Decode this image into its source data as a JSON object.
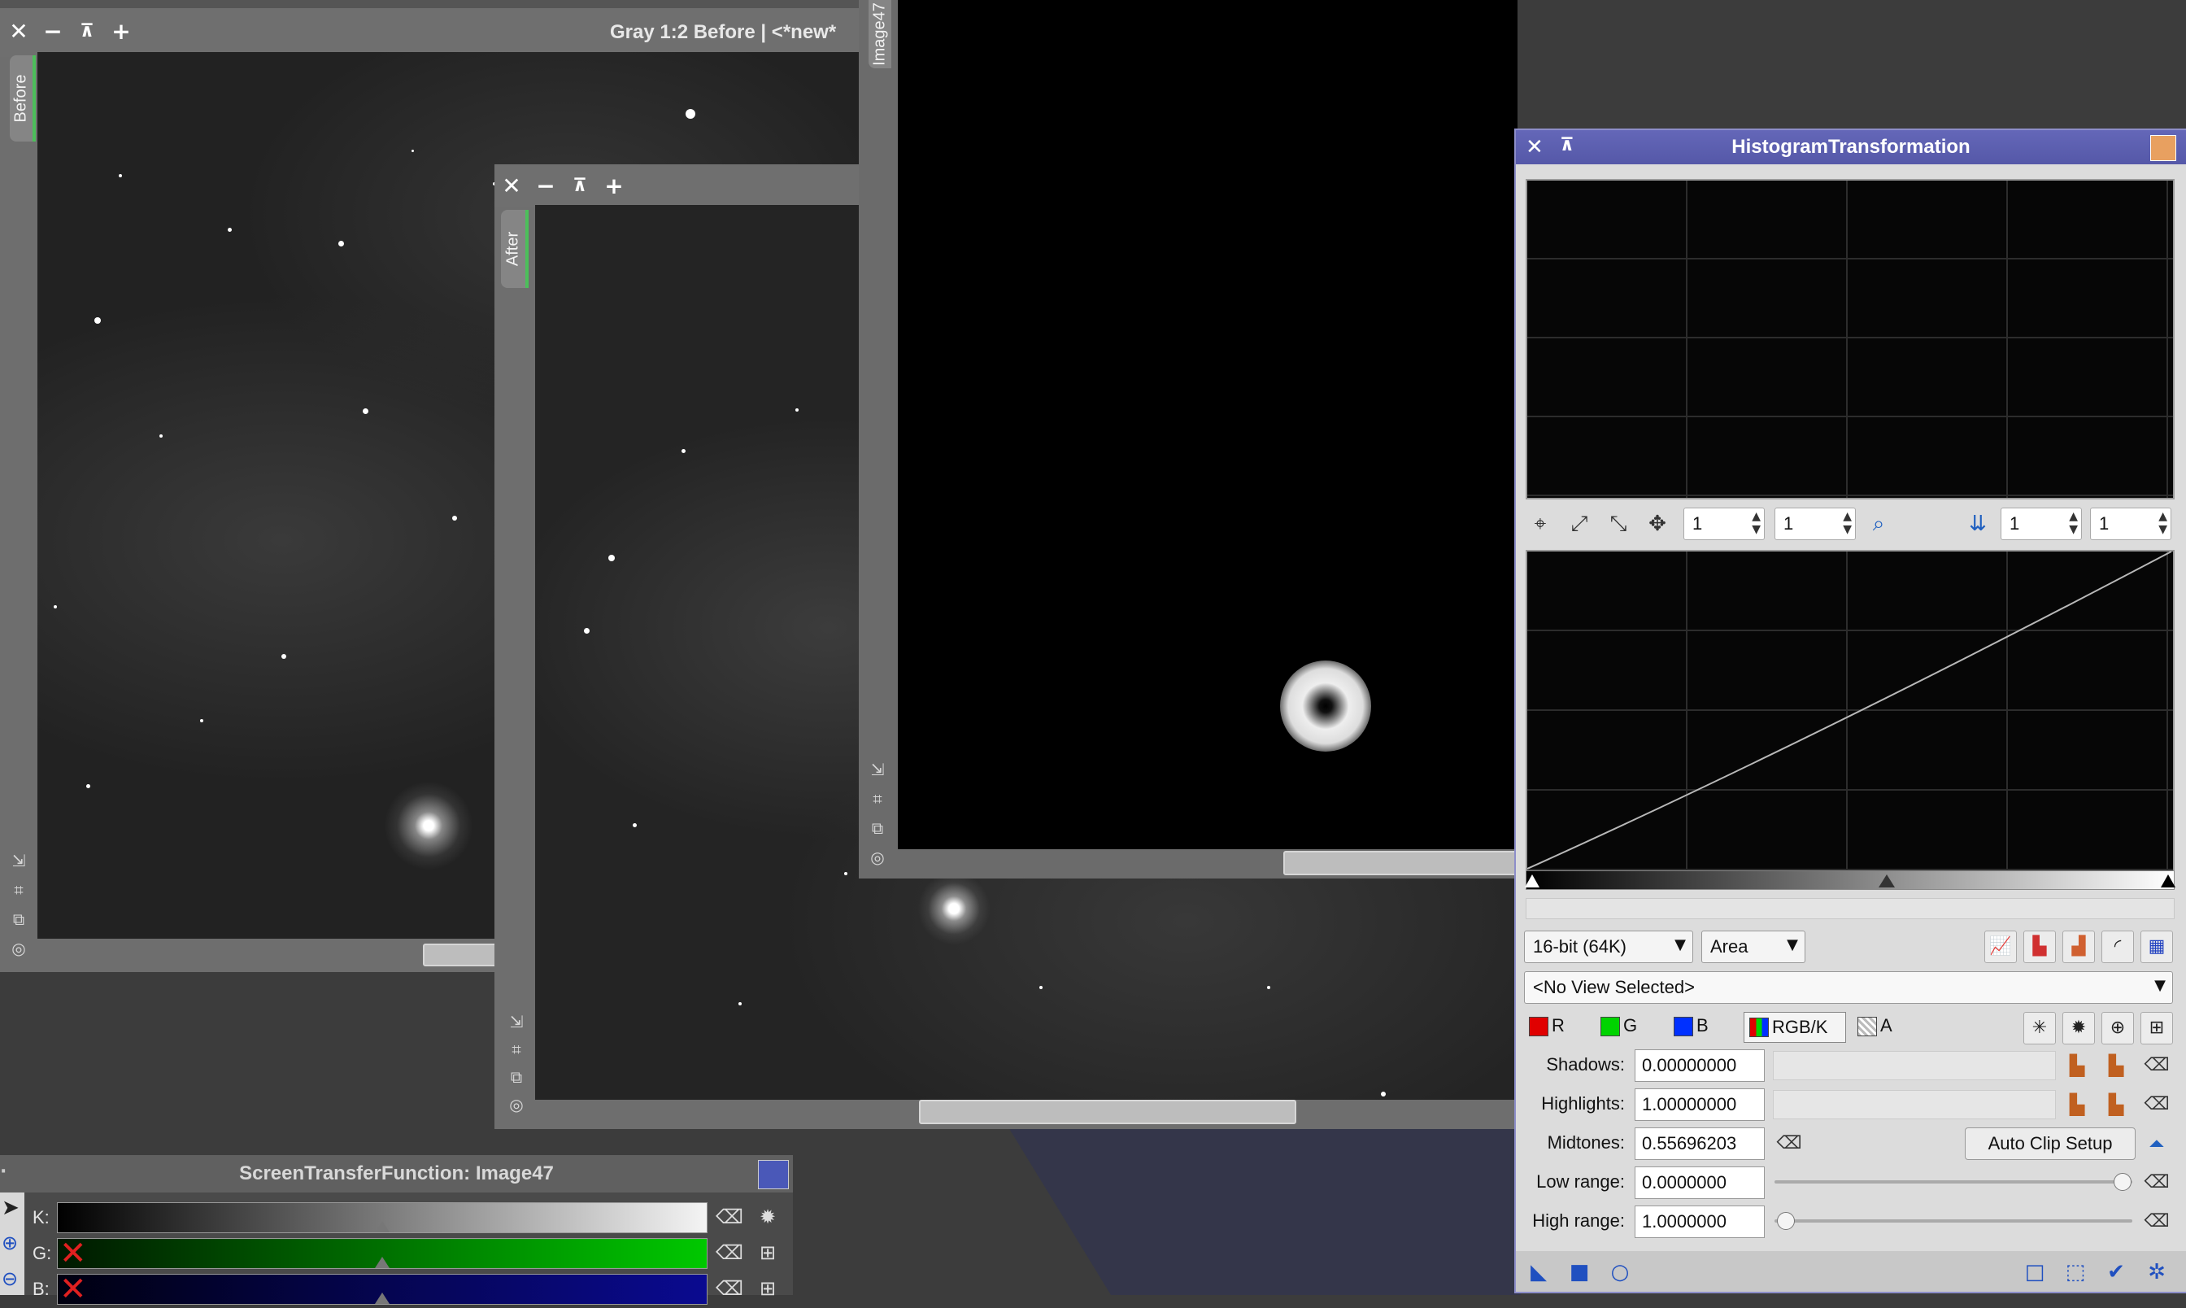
{
  "before_window": {
    "title": "Gray 1:2 Before | <*new*",
    "tab_label": "Before",
    "controls": [
      "✕",
      "−",
      "⊼",
      "+"
    ]
  },
  "after_window": {
    "tab_label": "After",
    "controls": [
      "✕",
      "−",
      "⊼",
      "+"
    ]
  },
  "image47_window": {
    "tab_label": "Image47"
  },
  "histogram": {
    "title": "HistogramTransformation",
    "zoom_h": "1",
    "zoom_v": "1",
    "input_zoom_h": "1",
    "input_zoom_v": "1",
    "resolution": "16-bit (64K)",
    "graph_style": "Area",
    "view_selector": "<No View Selected>",
    "channels": [
      {
        "label": "R",
        "color": "#e00000"
      },
      {
        "label": "G",
        "color": "#00d400"
      },
      {
        "label": "B",
        "color": "#0030ff"
      },
      {
        "label": "RGB/K",
        "color": "#888888"
      },
      {
        "label": "A",
        "color": "#cccccc"
      }
    ],
    "shadows_label": "Shadows:",
    "shadows_value": "0.00000000",
    "highlights_label": "Highlights:",
    "highlights_value": "1.00000000",
    "midtones_label": "Midtones:",
    "midtones_value": "0.55696203",
    "auto_clip_label": "Auto Clip Setup",
    "low_range_label": "Low range:",
    "low_range_value": "0.0000000",
    "high_range_label": "High range:",
    "high_range_value": "1.0000000",
    "midtones_fraction": 0.557,
    "low_range_slider_fraction": 0.97,
    "high_range_slider_fraction": 0.03
  },
  "stf": {
    "title": "ScreenTransferFunction: Image47",
    "rows": [
      {
        "label": "K:",
        "colors": [
          "#000000",
          "#f4f4f4"
        ]
      },
      {
        "label": "G:",
        "colors": [
          "#001800",
          "#00c800"
        ]
      },
      {
        "label": "B:",
        "colors": [
          "#000010",
          "#0a0a90"
        ]
      }
    ],
    "midtone_fraction": 0.5
  }
}
